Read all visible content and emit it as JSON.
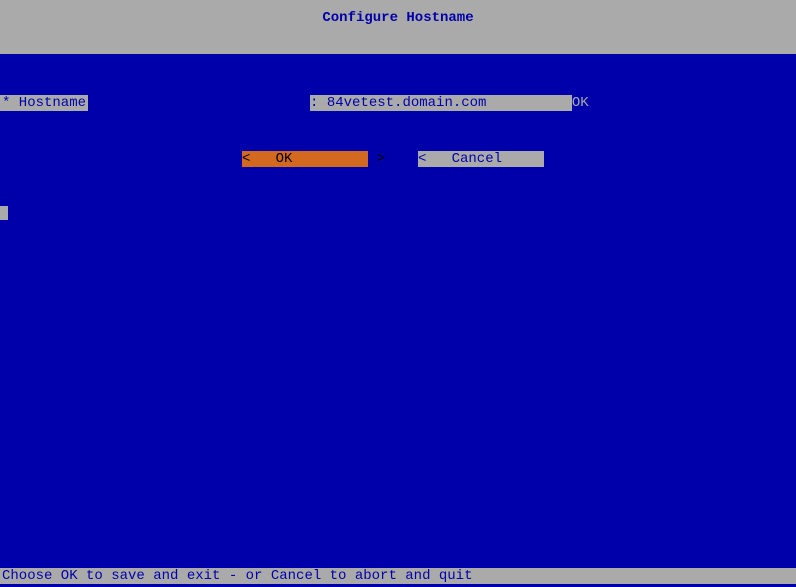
{
  "header": {
    "title": "Configure Hostname"
  },
  "form": {
    "field_label": "* Hostname",
    "separator": ": ",
    "hostname_value": "84vetest.domain.com",
    "status": "OK"
  },
  "buttons": {
    "ok_label": "<   OK          >",
    "cancel_label": "<   Cancel      >"
  },
  "footer": {
    "hint": "Choose OK to save and exit - or Cancel to abort and quit"
  }
}
